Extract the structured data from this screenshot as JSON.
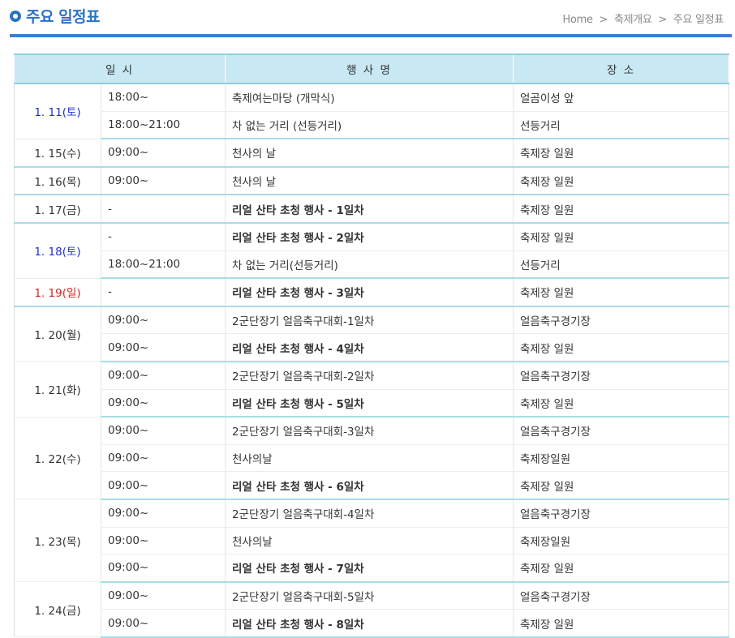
{
  "header": {
    "title": "주요 일정표",
    "breadcrumb": [
      "Home",
      "축제개요",
      "주요 일정표"
    ],
    "breadcrumb_sep": ">"
  },
  "colors": {
    "accent": "#2a73c4",
    "table_header_bg": "#c8e9f3",
    "saturday": "#1c2fd1",
    "sunday": "#e02020"
  },
  "table": {
    "columns": [
      "일 시",
      "행 사 명",
      "장 소"
    ],
    "days": [
      {
        "date": "1. 11(토)",
        "kind": "sat",
        "events": [
          {
            "time": "18:00~",
            "name": "축제여는마당 (개막식)",
            "place": "얼곰이성 앞",
            "bold": false
          },
          {
            "time": "18:00~21:00",
            "name": "차 없는 거리 (선등거리)",
            "place": "선등거리",
            "bold": false
          }
        ]
      },
      {
        "date": "1. 15(수)",
        "kind": "week",
        "events": [
          {
            "time": "09:00~",
            "name": "천사의 날",
            "place": "축제장 일원",
            "bold": false
          }
        ]
      },
      {
        "date": "1. 16(목)",
        "kind": "week",
        "events": [
          {
            "time": "09:00~",
            "name": "천사의 날",
            "place": "축제장 일원",
            "bold": false
          }
        ]
      },
      {
        "date": "1. 17(금)",
        "kind": "week",
        "events": [
          {
            "time": "-",
            "name": "리얼 산타 초청 행사 - 1일차",
            "place": "축제장 일원",
            "bold": true
          }
        ]
      },
      {
        "date": "1. 18(토)",
        "kind": "sat",
        "events": [
          {
            "time": "-",
            "name": "리얼 산타 초청 행사 - 2일차",
            "place": "축제장 일원",
            "bold": true
          },
          {
            "time": "18:00~21:00",
            "name": "차 없는 거리(선등거리)",
            "place": "선등거리",
            "bold": false
          }
        ]
      },
      {
        "date": "1. 19(일)",
        "kind": "sun",
        "events": [
          {
            "time": "-",
            "name": "리얼 산타 초청 행사 - 3일차",
            "place": "축제장 일원",
            "bold": true
          }
        ]
      },
      {
        "date": "1. 20(월)",
        "kind": "week",
        "events": [
          {
            "time": "09:00~",
            "name": "2군단장기 얼음축구대회-1일차",
            "place": "얼음축구경기장",
            "bold": false
          },
          {
            "time": "09:00~",
            "name": "리얼 산타 초청 행사 - 4일차",
            "place": "축제장 일원",
            "bold": true
          }
        ]
      },
      {
        "date": "1. 21(화)",
        "kind": "week",
        "events": [
          {
            "time": "09:00~",
            "name": "2군단장기 얼음축구대회-2일차",
            "place": "얼음축구경기장",
            "bold": false
          },
          {
            "time": "09:00~",
            "name": "리얼 산타 초청 행사 - 5일차",
            "place": "축제장 일원",
            "bold": true
          }
        ]
      },
      {
        "date": "1. 22(수)",
        "kind": "week",
        "events": [
          {
            "time": "09:00~",
            "name": "2군단장기 얼음축구대회-3일차",
            "place": "얼음축구경기장",
            "bold": false
          },
          {
            "time": "09:00~",
            "name": "천사의날",
            "place": "축제장일원",
            "bold": false
          },
          {
            "time": "09:00~",
            "name": "리얼 산타 초청 행사 - 6일차",
            "place": "축제장 일원",
            "bold": true
          }
        ]
      },
      {
        "date": "1. 23(목)",
        "kind": "week",
        "events": [
          {
            "time": "09:00~",
            "name": "2군단장기 얼음축구대회-4일차",
            "place": "얼음축구경기장",
            "bold": false
          },
          {
            "time": "09:00~",
            "name": "천사의날",
            "place": "축제장일원",
            "bold": false
          },
          {
            "time": "09:00~",
            "name": "리얼 산타 초청 행사 - 7일차",
            "place": "축제장 일원",
            "bold": true
          }
        ]
      },
      {
        "date": "1. 24(금)",
        "kind": "week",
        "events": [
          {
            "time": "09:00~",
            "name": "2군단장기 얼음축구대회-5일차",
            "place": "얼음축구경기장",
            "bold": false
          },
          {
            "time": "09:00~",
            "name": "리얼 산타 초청 행사 - 8일차",
            "place": "축제장 일원",
            "bold": true
          }
        ]
      }
    ]
  }
}
